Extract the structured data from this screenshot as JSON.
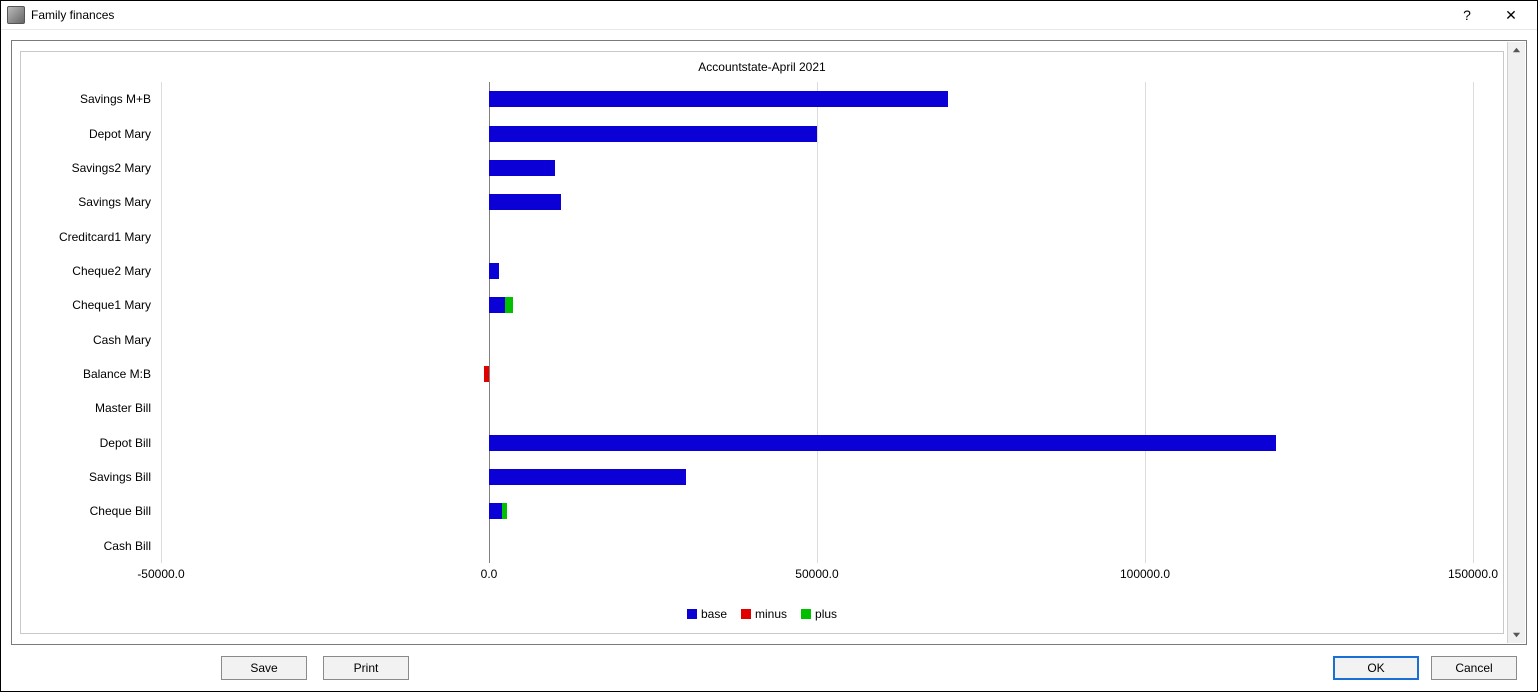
{
  "window": {
    "title": "Family finances",
    "help_label": "?",
    "close_label": "✕"
  },
  "buttons": {
    "save": "Save",
    "print": "Print",
    "ok": "OK",
    "cancel": "Cancel"
  },
  "legend": {
    "base": "base",
    "minus": "minus",
    "plus": "plus"
  },
  "chart_data": {
    "type": "bar",
    "orientation": "horizontal",
    "stacked": true,
    "title": "Accountstate-April 2021",
    "xlabel": "",
    "ylabel": "",
    "xlim": [
      -50000,
      150000
    ],
    "xticks": [
      -50000,
      0,
      50000,
      100000,
      150000
    ],
    "xtick_labels": [
      "-50000.0",
      "0.0",
      "50000.0",
      "100000.0",
      "150000.0"
    ],
    "categories": [
      "Savings M+B",
      "Depot Mary",
      "Savings2 Mary",
      "Savings Mary",
      "Creditcard1 Mary",
      "Cheque2 Mary",
      "Cheque1 Mary",
      "Cash Mary",
      "Balance M:B",
      "Master Bill",
      "Depot Bill",
      "Savings Bill",
      "Cheque Bill",
      "Cash Bill"
    ],
    "series": [
      {
        "name": "base",
        "color": "#0b00d6",
        "values": [
          70000,
          50000,
          10000,
          11000,
          0,
          1500,
          2500,
          0,
          0,
          0,
          120000,
          30000,
          2000,
          0
        ]
      },
      {
        "name": "minus",
        "color": "#e00000",
        "values": [
          0,
          0,
          0,
          0,
          0,
          0,
          0,
          0,
          -700,
          0,
          0,
          0,
          0,
          0
        ]
      },
      {
        "name": "plus",
        "color": "#00c000",
        "values": [
          0,
          0,
          0,
          0,
          0,
          0,
          1200,
          0,
          0,
          0,
          0,
          0,
          800,
          0
        ]
      }
    ],
    "legend_position": "bottom",
    "grid": true
  }
}
